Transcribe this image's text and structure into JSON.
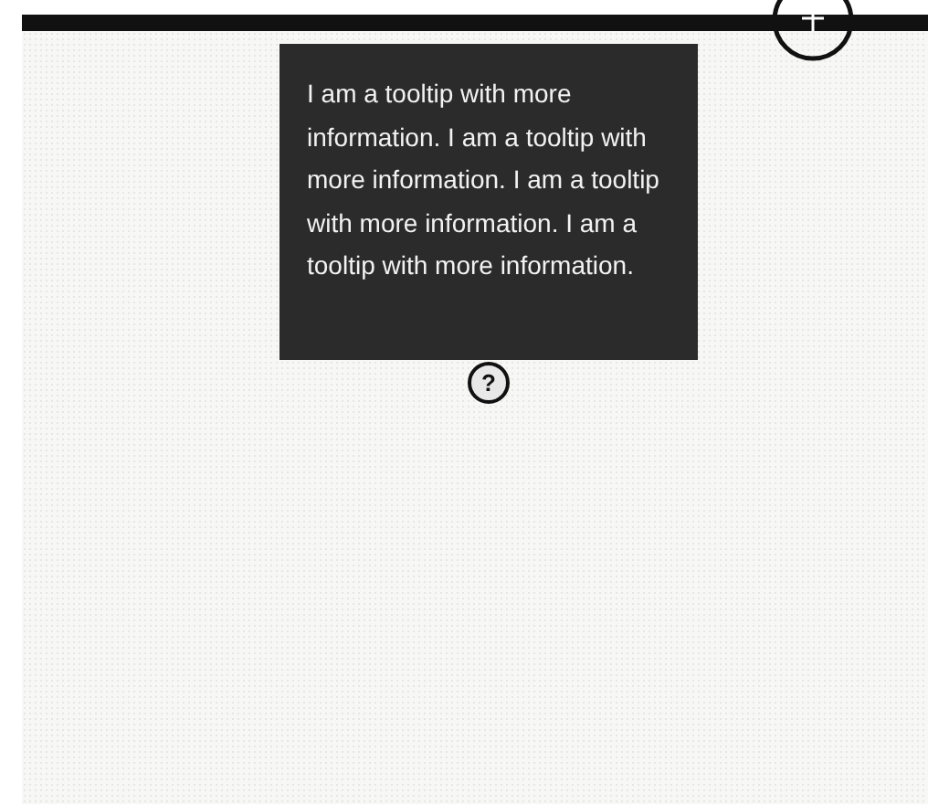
{
  "tooltip": {
    "text": "I am a tooltip with more information. I am a tooltip with more information. I am a tooltip with more information. I am a tooltip with more information."
  },
  "help_button": {
    "label": "?"
  }
}
